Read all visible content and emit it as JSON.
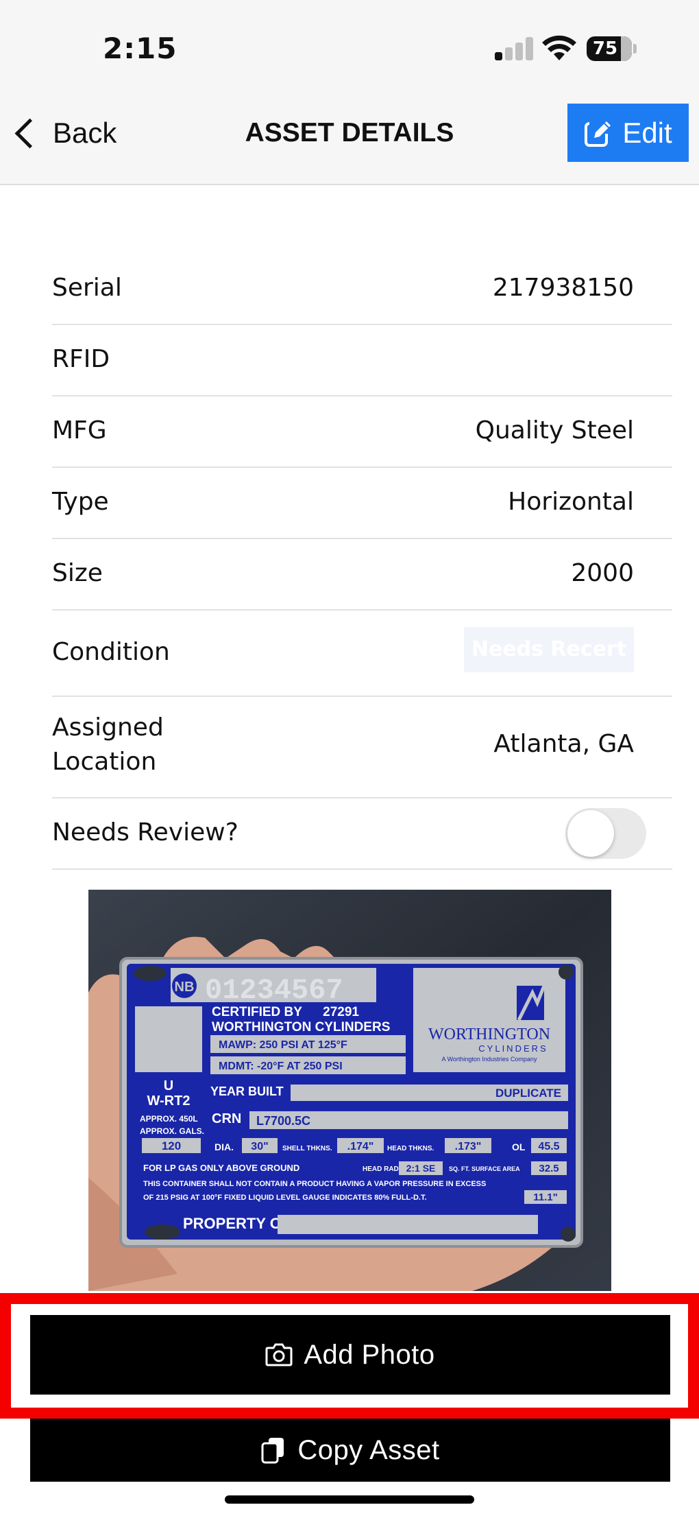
{
  "status_bar": {
    "time": "2:15",
    "battery": "75"
  },
  "nav": {
    "back_label": "Back",
    "title": "ASSET DETAILS",
    "edit_label": "Edit",
    "accent_color": "#1e7cf3"
  },
  "details": [
    {
      "label": "Serial",
      "value": "217938150"
    },
    {
      "label": "RFID",
      "value": ""
    },
    {
      "label": "MFG",
      "value": "Quality Steel"
    },
    {
      "label": "Type",
      "value": "Horizontal"
    },
    {
      "label": "Size",
      "value": "2000"
    },
    {
      "label": "Condition",
      "value": "Needs Recert"
    },
    {
      "label": "Assigned\nLocation",
      "value": "Atlanta, GA"
    },
    {
      "label": "Needs Review?",
      "value": false
    }
  ],
  "photo": {
    "plate": {
      "serial": "01234567",
      "certified_by": "CERTIFIED BY",
      "cert_number": "27291",
      "maker": "WORTHINGTON CYLINDERS",
      "mawp": "MAWP: 250 PSI AT 125°F",
      "mdmt": "MDMT: -20°F AT 250 PSI",
      "brand": "WORTHINGTON",
      "brand_sub": "CYLINDERS",
      "brand_tag": "A Worthington Industries Company",
      "u_mark": "U",
      "model": "W-RT2",
      "year_built": "YEAR BUILT",
      "duplicate": "DUPLICATE",
      "approx_l": "APPROX. 450L",
      "approx_gals": "APPROX. GALS.",
      "gals": "120",
      "crn_label": "CRN",
      "crn": "L7700.5C",
      "dia_label": "DIA.",
      "dia": "30\"",
      "shell_label": "SHELL THKNS.",
      "shell": ".174\"",
      "head_label": "HEAD THKNS.",
      "head": ".173\"",
      "ol_label": "OL",
      "ol": "45.5",
      "lp_gas": "FOR LP GAS ONLY ABOVE GROUND",
      "head_rad_label": "HEAD RAD.",
      "head_rad": "2:1 SE",
      "surface_label": "SQ. FT. SURFACE AREA",
      "surface": "32.5",
      "warning1": "THIS CONTAINER SHALL NOT CONTAIN A PRODUCT HAVING A VAPOR PRESSURE IN EXCESS",
      "warning2": "OF 215 PSIG AT 100°F FIXED LIQUID LEVEL GAUGE INDICATES 80% FULL-D.T.",
      "gauge": "11.1\"",
      "property_of": "PROPERTY OF"
    }
  },
  "actions": {
    "add_photo_label": "Add Photo",
    "copy_asset_label": "Copy Asset",
    "highlight_color": "#f50000"
  }
}
